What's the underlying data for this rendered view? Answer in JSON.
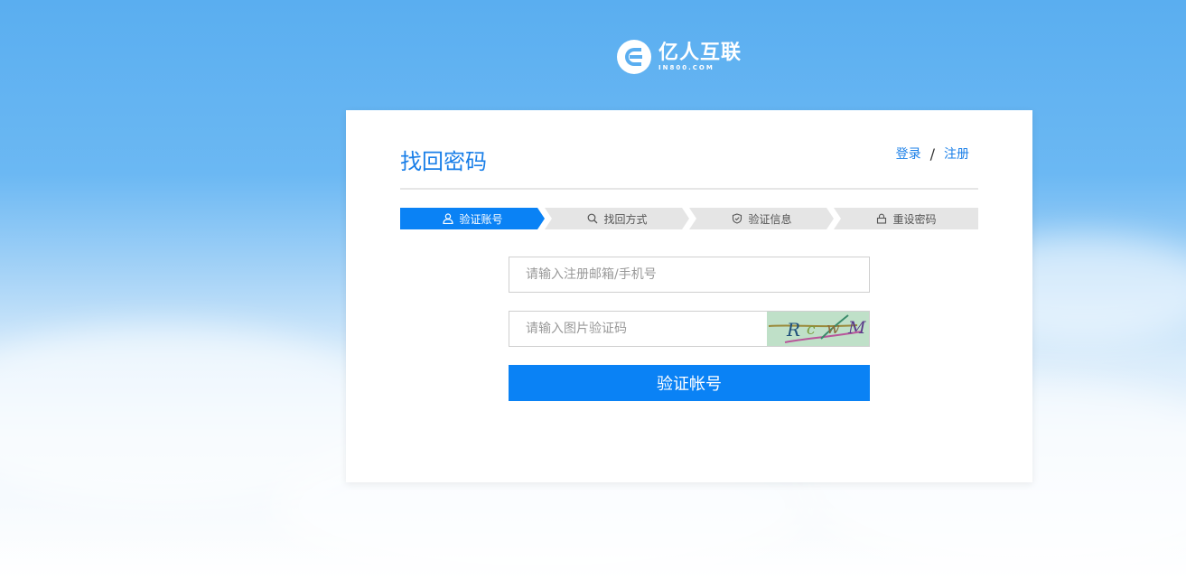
{
  "brand": {
    "name_cn": "亿人互联",
    "name_en": "IN800.COM"
  },
  "page": {
    "title": "找回密码",
    "login_link": "登录",
    "separator": "/",
    "register_link": "注册"
  },
  "steps": [
    {
      "label": "验证账号",
      "icon": "user-icon",
      "active": true
    },
    {
      "label": "找回方式",
      "icon": "search-icon",
      "active": false
    },
    {
      "label": "验证信息",
      "icon": "shield-icon",
      "active": false
    },
    {
      "label": "重设密码",
      "icon": "lock-icon",
      "active": false
    }
  ],
  "form": {
    "account_placeholder": "请输入注册邮箱/手机号",
    "captcha_placeholder": "请输入图片验证码",
    "captcha_text": "RcwM",
    "submit_label": "验证帐号"
  },
  "colors": {
    "accent": "#0a82f5",
    "title": "#1a7fe8",
    "step_inactive": "#e5e5e5",
    "captcha_bg": "#bfe0c8"
  }
}
